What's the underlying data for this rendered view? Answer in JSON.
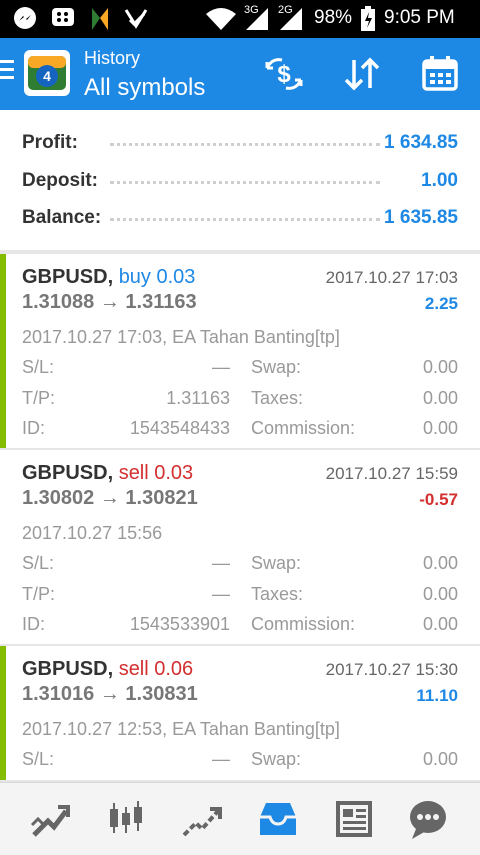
{
  "status_bar": {
    "network": "3G",
    "network2": "2G",
    "battery": "98%",
    "time": "9:05 PM"
  },
  "app_bar": {
    "title_small": "History",
    "title_big": "All symbols"
  },
  "summary": [
    {
      "label": "Profit:",
      "value": "1 634.85"
    },
    {
      "label": "Deposit:",
      "value": "1.00"
    },
    {
      "label": "Balance:",
      "value": "1 635.85"
    }
  ],
  "deals": [
    {
      "symbol": "GBPUSD,",
      "type": "buy 0.03",
      "type_color": "#1e88e5",
      "time": "2017.10.27 17:03",
      "prices": "1.31088 → 1.31163",
      "profit": "2.25",
      "profit_color": "#1e88e5",
      "open": "2017.10.27 17:03, EA Tahan Banting[tp]",
      "bar": true,
      "sl_label": "S/L:",
      "sl": "—",
      "tp_label": "T/P:",
      "tp": "1.31163",
      "id_label": "ID:",
      "id": "1543548433",
      "swap_label": "Swap:",
      "swap": "0.00",
      "taxes_label": "Taxes:",
      "taxes": "0.00",
      "comm_label": "Commission:",
      "comm": "0.00"
    },
    {
      "symbol": "GBPUSD,",
      "type": "sell 0.03",
      "type_color": "#d32f2f",
      "time": "2017.10.27 15:59",
      "prices": "1.30802 → 1.30821",
      "profit": "-0.57",
      "profit_color": "#d32f2f",
      "open": "2017.10.27 15:56",
      "bar": false,
      "sl_label": "S/L:",
      "sl": "—",
      "tp_label": "T/P:",
      "tp": "—",
      "id_label": "ID:",
      "id": "1543533901",
      "swap_label": "Swap:",
      "swap": "0.00",
      "taxes_label": "Taxes:",
      "taxes": "0.00",
      "comm_label": "Commission:",
      "comm": "0.00"
    },
    {
      "symbol": "GBPUSD,",
      "type": "sell 0.06",
      "type_color": "#d32f2f",
      "time": "2017.10.27 15:30",
      "prices": "1.31016 → 1.30831",
      "profit": "11.10",
      "profit_color": "#1e88e5",
      "open": "2017.10.27 12:53, EA Tahan Banting[tp]",
      "bar": true,
      "sl_label": "S/L:",
      "sl": "—",
      "swap_label": "Swap:",
      "swap": "0.00"
    }
  ],
  "bottom_nav": [
    {
      "icon": "quotes-icon"
    },
    {
      "icon": "chart-icon"
    },
    {
      "icon": "trade-icon"
    },
    {
      "icon": "history-icon",
      "active": true
    },
    {
      "icon": "news-icon"
    },
    {
      "icon": "chat-icon"
    }
  ],
  "colors": {
    "accent": "#1e88e5",
    "loss": "#d32f2f",
    "bar": "#84bd00"
  }
}
